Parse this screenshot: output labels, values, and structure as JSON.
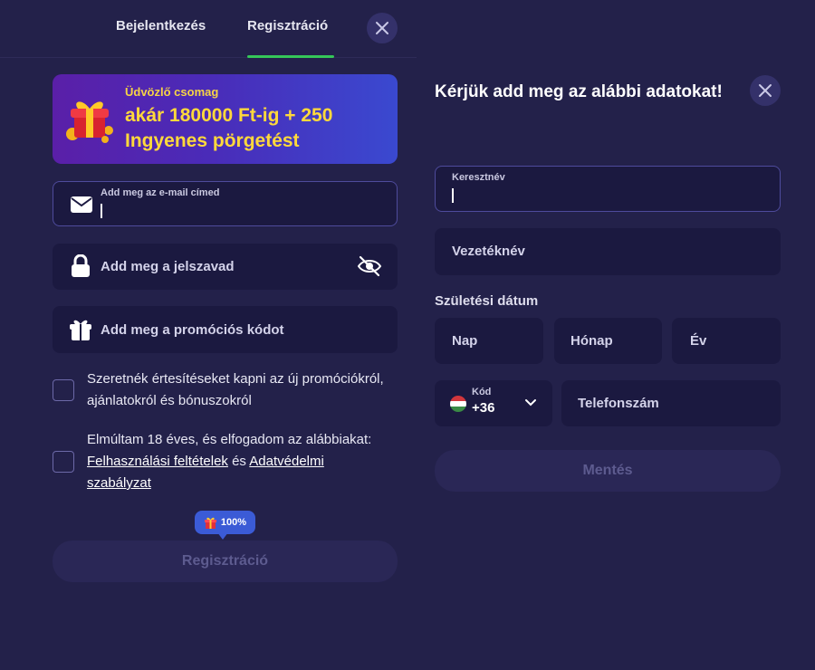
{
  "tabs": {
    "login": "Bejelentkezés",
    "register": "Regisztráció"
  },
  "promo": {
    "small": "Üdvözlő csomag",
    "big": "akár 180000 Ft-ig + 250 Ingyenes pörgetést"
  },
  "form": {
    "email_label": "Add meg az e-mail címed",
    "password_placeholder": "Add meg a jelszavad",
    "promo_placeholder": "Add meg a promóciós kódot",
    "consent_notifications": "Szeretnék értesítéseket kapni az új promóciókról, ajánlatokról és bónuszokról",
    "consent_age_prefix": "Elmúltam 18 éves, és elfogadom az alábbiakat:",
    "terms_link": "Felhasználási feltételek",
    "and": "és",
    "privacy_link": "Adatvédelmi szabályzat",
    "bonus_badge": "100%",
    "submit": "Regisztráció"
  },
  "details": {
    "title": "Kérjük add meg az alábbi adatokat!",
    "first_name_label": "Keresztnév",
    "last_name_placeholder": "Vezetéknév",
    "dob_label": "Születési dátum",
    "day_placeholder": "Nap",
    "month_placeholder": "Hónap",
    "year_placeholder": "Év",
    "code_label": "Kód",
    "code_value": "+36",
    "phone_placeholder": "Telefonszám",
    "save": "Mentés"
  },
  "colors": {
    "background": "#23214a",
    "field": "#1b1940",
    "accent_green": "#35c759",
    "promo_yellow": "#ffd93b",
    "badge_blue": "#3b5bd6"
  },
  "icons": [
    "close-icon",
    "gift-icon",
    "mail-icon",
    "lock-icon",
    "eye-off-icon",
    "present-icon",
    "hungary-flag-icon",
    "chevron-down-icon"
  ]
}
